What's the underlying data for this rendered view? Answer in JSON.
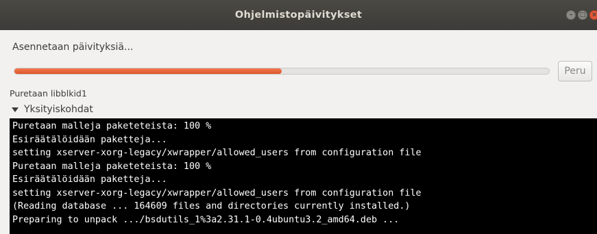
{
  "window": {
    "title": "Ohjelmistopäivitykset",
    "buttons": [
      "minimize-icon",
      "maximize-icon",
      "close-icon"
    ]
  },
  "status": {
    "text": "Asennetaan päivityksiä..."
  },
  "progress": {
    "fraction": 0.5,
    "color": "#e95420"
  },
  "cancel_label": "Peru",
  "substatus": "Puretaan libblkid1",
  "details": {
    "label": "Yksityiskohdat",
    "expanded": true
  },
  "terminal": {
    "lines": [
      "Puretaan malleja paketeteista: 100 %",
      "Esiräätälöidään paketteja...",
      "setting xserver-xorg-legacy/xwrapper/allowed_users from configuration file",
      "Puretaan malleja paketeteista: 100 %",
      "Esiräätälöidään paketteja...",
      "setting xserver-xorg-legacy/xwrapper/allowed_users from configuration file",
      "(Reading database ... 164609 files and directories currently installed.)",
      "Preparing to unpack .../bsdutils_1%3a2.31.1-0.4ubuntu3.2_amd64.deb ..."
    ]
  }
}
